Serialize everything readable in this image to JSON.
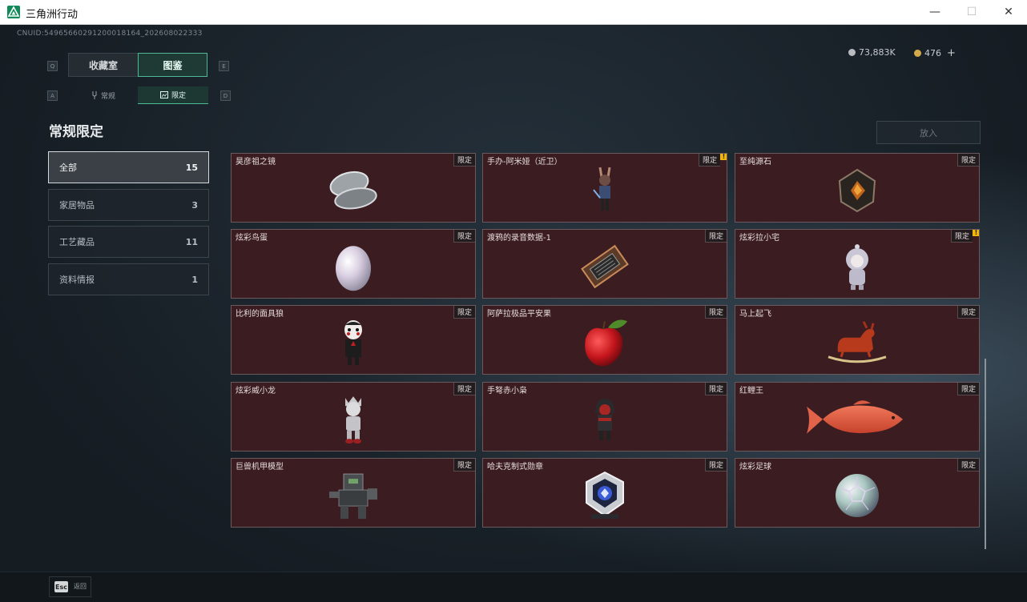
{
  "window": {
    "title": "三角洲行动",
    "minimize_glyph": "—",
    "maximize_glyph": "☐",
    "close_glyph": "✕"
  },
  "header": {
    "uid": "CNUID:5496566029120001816​4_202608022333",
    "currency": [
      {
        "icon": "silver-coin-icon",
        "value": "73,883K",
        "color": "#b8bcc0"
      },
      {
        "icon": "gold-coin-icon",
        "value": "476",
        "color": "#d4a94a"
      }
    ],
    "add_glyph": "+"
  },
  "tabs": {
    "left_key": "Q",
    "right_key": "E",
    "items": [
      {
        "label": "收藏室",
        "active": false
      },
      {
        "label": "图鉴",
        "active": true
      }
    ]
  },
  "subtabs": {
    "left_key": "A",
    "right_key": "D",
    "items": [
      {
        "label": "常规",
        "icon": "tuning-fork-icon",
        "active": false
      },
      {
        "label": "限定",
        "icon": "image-frame-icon",
        "active": true
      }
    ]
  },
  "section_title": "常规限定",
  "put_button": "放入",
  "categories": [
    {
      "label": "全部",
      "count": "15",
      "active": true
    },
    {
      "label": "家居物品",
      "count": "3",
      "active": false
    },
    {
      "label": "工艺藏品",
      "count": "11",
      "active": false
    },
    {
      "label": "资料情报",
      "count": "1",
      "active": false
    }
  ],
  "tag_label": "限定",
  "items": [
    {
      "name": "昊彦祖之镜",
      "icon": "compact-mirror-icon",
      "alert": false
    },
    {
      "name": "手办-阿米娅（近卫）",
      "icon": "figure-amiya-icon",
      "alert": true
    },
    {
      "name": "至纯源石",
      "icon": "originium-crystal-icon",
      "alert": false
    },
    {
      "name": "炫彩鸟蛋",
      "icon": "pearl-egg-icon",
      "alert": false
    },
    {
      "name": "渡鸦的录音数据-1",
      "icon": "recorder-device-icon",
      "alert": false
    },
    {
      "name": "炫彩拉小宅",
      "icon": "hooded-figure-icon",
      "alert": true
    },
    {
      "name": "比利的面具狼",
      "icon": "jigsaw-puppet-icon",
      "alert": false
    },
    {
      "name": "阿萨拉极品平安果",
      "icon": "red-apple-icon",
      "alert": false
    },
    {
      "name": "马上起飞",
      "icon": "rocking-horse-icon",
      "alert": false
    },
    {
      "name": "炫彩威小龙",
      "icon": "silver-figure-icon",
      "alert": false
    },
    {
      "name": "手弩赤小枭",
      "icon": "red-hooded-figure-icon",
      "alert": false
    },
    {
      "name": "红鲤王",
      "icon": "red-carp-icon",
      "alert": false
    },
    {
      "name": "巨兽机甲模型",
      "icon": "mech-model-icon",
      "alert": false
    },
    {
      "name": "哈夫克制式勋章",
      "icon": "medal-badge-icon",
      "alert": false
    },
    {
      "name": "炫彩足球",
      "icon": "iridescent-football-icon",
      "alert": false
    }
  ],
  "alert_glyph": "!",
  "footer": {
    "esc_key": "Esc",
    "back_label": "返回"
  }
}
